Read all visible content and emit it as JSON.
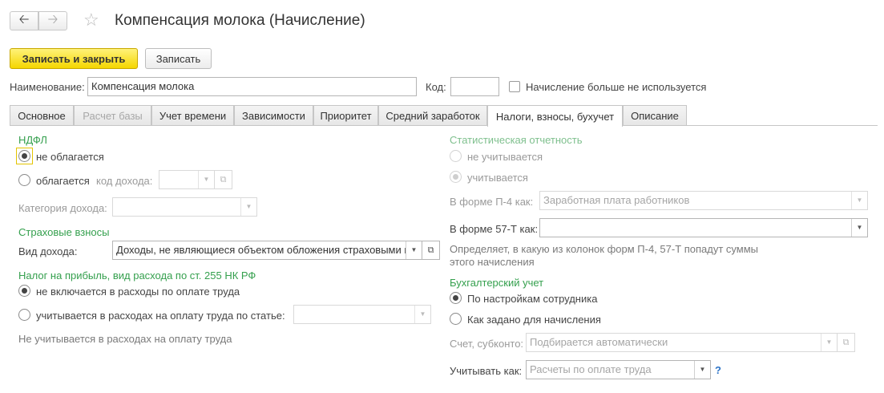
{
  "window": {
    "title": "Компенсация молока (Начисление)",
    "nav_back_icon": "arrow-left-icon",
    "nav_forward_icon": "arrow-right-icon",
    "favorite_icon": "star-icon"
  },
  "toolbar": {
    "save_close_label": "Записать и закрыть",
    "save_label": "Записать"
  },
  "header": {
    "name_label": "Наименование:",
    "name_value": "Компенсация молока",
    "code_label": "Код:",
    "code_value": "",
    "unused_label": "Начисление больше не используется",
    "unused_checked": false
  },
  "tabs": [
    {
      "label": "Основное",
      "enabled": true
    },
    {
      "label": "Расчет базы",
      "enabled": false
    },
    {
      "label": "Учет времени",
      "enabled": true
    },
    {
      "label": "Зависимости",
      "enabled": true
    },
    {
      "label": "Приоритет",
      "enabled": true
    },
    {
      "label": "Средний заработок",
      "enabled": true
    },
    {
      "label": "Налоги, взносы, бухучет",
      "enabled": true,
      "active": true
    },
    {
      "label": "Описание",
      "enabled": true
    }
  ],
  "ndfl": {
    "heading": "НДФЛ",
    "opt_not_taxed": "не облагается",
    "opt_taxed": "облагается",
    "income_code_label": "код дохода:",
    "income_code_value": "",
    "income_category_label": "Категория дохода:",
    "income_category_value": "",
    "selected": "not_taxed"
  },
  "insurance": {
    "heading": "Страховые взносы",
    "income_type_label": "Вид дохода:",
    "income_type_value": "Доходы, не являющиеся объектом обложения страховыми взносами"
  },
  "profit_tax": {
    "heading": "Налог на прибыль, вид расхода по ст. 255 НК РФ",
    "opt_not_included": "не включается в расходы по оплате труда",
    "opt_included": "учитывается в расходах на оплату труда по статье:",
    "article_value": "",
    "note": "Не учитывается в расходах на оплату труда",
    "selected": "not_included"
  },
  "statistics": {
    "heading": "Статистическая отчетность",
    "opt_not_counted": "не учитывается",
    "opt_counted": "учитывается",
    "p4_label": "В форме П-4 как:",
    "p4_value": "Заработная плата работников",
    "t57_label": "В форме 57-Т как:",
    "t57_value": "",
    "note": "Определяет, в какую из колонок форм П-4, 57-Т попадут суммы этого начисления",
    "selected": "counted"
  },
  "accounting": {
    "heading": "Бухгалтерский учет",
    "opt_by_employee": "По настройкам сотрудника",
    "opt_by_accrual": "Как задано для начисления",
    "account_label": "Счет, субконто:",
    "account_placeholder": "Подбирается автоматически",
    "consider_label": "Учитывать как:",
    "consider_placeholder": "Расчеты по оплате труда",
    "help_label": "?",
    "selected": "by_employee"
  }
}
